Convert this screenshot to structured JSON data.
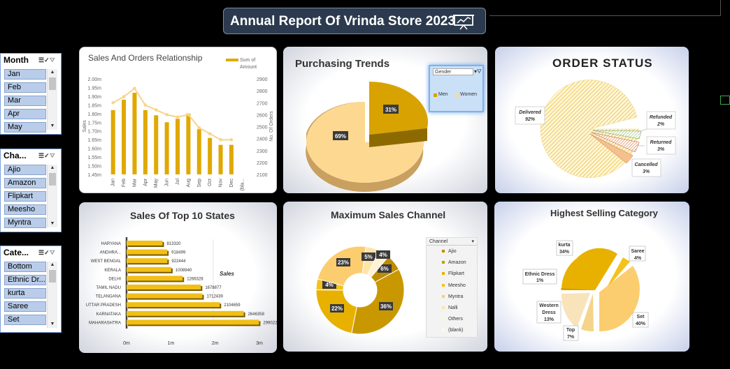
{
  "header": {
    "title": "Annual Report Of Vrinda Store 2023",
    "icon": "presentation-board-icon"
  },
  "slicers": [
    {
      "title": "Month",
      "items": [
        "Jan",
        "Feb",
        "Mar",
        "Apr",
        "May"
      ]
    },
    {
      "title": "Cha...",
      "items": [
        "Ajio",
        "Amazon",
        "Flipkart",
        "Meesho",
        "Myntra"
      ]
    },
    {
      "title": "Cate...",
      "items": [
        "Bottom",
        "Ethnic Dr...",
        "kurta",
        "Saree",
        "Set"
      ]
    }
  ],
  "chart_data": [
    {
      "type": "bar",
      "title": "Sales And Orders Relationship",
      "legend": [
        "Sum of Amount"
      ],
      "ylabel": "Sales",
      "ylabel2": "No. Of Orders",
      "categories": [
        "Jan",
        "Feb",
        "Mar",
        "Apr",
        "May",
        "Jun",
        "Jul",
        "Aug",
        "Sep",
        "Oct",
        "Nov",
        "Dec",
        "(bla..."
      ],
      "y_ticks": [
        "1.45m",
        "1.50m",
        "1.55m",
        "1.60m",
        "1.65m",
        "1.70m",
        "1.75m",
        "1.80m",
        "1.85m",
        "1.90m",
        "1.95m",
        "2.00m"
      ],
      "y2_ticks": [
        "2100",
        "2200",
        "2300",
        "2400",
        "2500",
        "2600",
        "2700",
        "2800",
        "2900"
      ],
      "ylim": [
        1.45,
        2.0
      ],
      "y2lim": [
        2100,
        2900
      ],
      "series": [
        {
          "name": "Sum of Amount",
          "type": "bar",
          "values": [
            1.82,
            1.88,
            1.92,
            1.82,
            1.79,
            1.75,
            1.77,
            1.8,
            1.71,
            1.66,
            1.62,
            1.62,
            null
          ]
        },
        {
          "type": "line",
          "values": [
            2700,
            2750,
            2820,
            2680,
            2640,
            2600,
            2580,
            2600,
            2490,
            2440,
            2390,
            2390,
            null
          ]
        }
      ]
    },
    {
      "type": "pie",
      "title": "Purchasing Trends",
      "legend_title": "Gender",
      "categories": [
        "Men",
        "Women"
      ],
      "values": [
        31,
        69
      ],
      "labels": [
        "31%",
        "69%"
      ],
      "colors": [
        "#d8a300",
        "#fdd891"
      ]
    },
    {
      "type": "pie",
      "title": "ORDER STATUS",
      "categories": [
        "Delivered",
        "Refunded",
        "Returned",
        "Cancelled"
      ],
      "values": [
        92,
        2,
        3,
        3
      ],
      "labels": [
        "Delivered\n92%",
        "Refunded\n2%",
        "Returned\n3%",
        "Cancelled\n3%"
      ]
    },
    {
      "type": "bar",
      "title": "Sales Of Top 10 States",
      "legend": [
        "Sales"
      ],
      "categories": [
        "HARYANA",
        "ANDHRA...",
        "WEST BENGAL",
        "KERALA",
        "DELHI",
        "TAMIL NADU",
        "TELANGANA",
        "UTTAR PRADESH",
        "KARNATAKA",
        "MAHARASHTRA"
      ],
      "values": [
        813320,
        918499,
        922444,
        1008940,
        1266328,
        1678877,
        1712439,
        2104659,
        2646358,
        2990221
      ],
      "x_ticks": [
        "0m",
        "1m",
        "2m",
        "3m"
      ],
      "xlim": [
        0,
        3000000
      ]
    },
    {
      "type": "pie",
      "title": "Maximum Sales Channel",
      "legend_title": "Channel",
      "categories": [
        "Ajio",
        "Amazon",
        "Flipkart",
        "Meesho",
        "Myntra",
        "Nalli",
        "Others",
        "(blank)"
      ],
      "values": [
        6,
        36,
        22,
        4,
        23,
        5,
        4,
        0
      ],
      "labels": [
        "6%",
        "36%",
        "22%",
        "4%",
        "23%",
        "5%",
        "4%",
        ""
      ]
    },
    {
      "type": "pie",
      "title": "Highest Selling Category",
      "categories": [
        "Saree",
        "Set",
        "Top",
        "Western Dress",
        "Ethnic Dress",
        "kurta"
      ],
      "values": [
        4,
        40,
        7,
        13,
        1,
        34
      ],
      "labels": [
        "Saree\n4%",
        "Set\n40%",
        "Top\n7%",
        "Western\nDress\n13%",
        "Ethnic Dress\n1%",
        "kurta\n34%"
      ]
    }
  ]
}
